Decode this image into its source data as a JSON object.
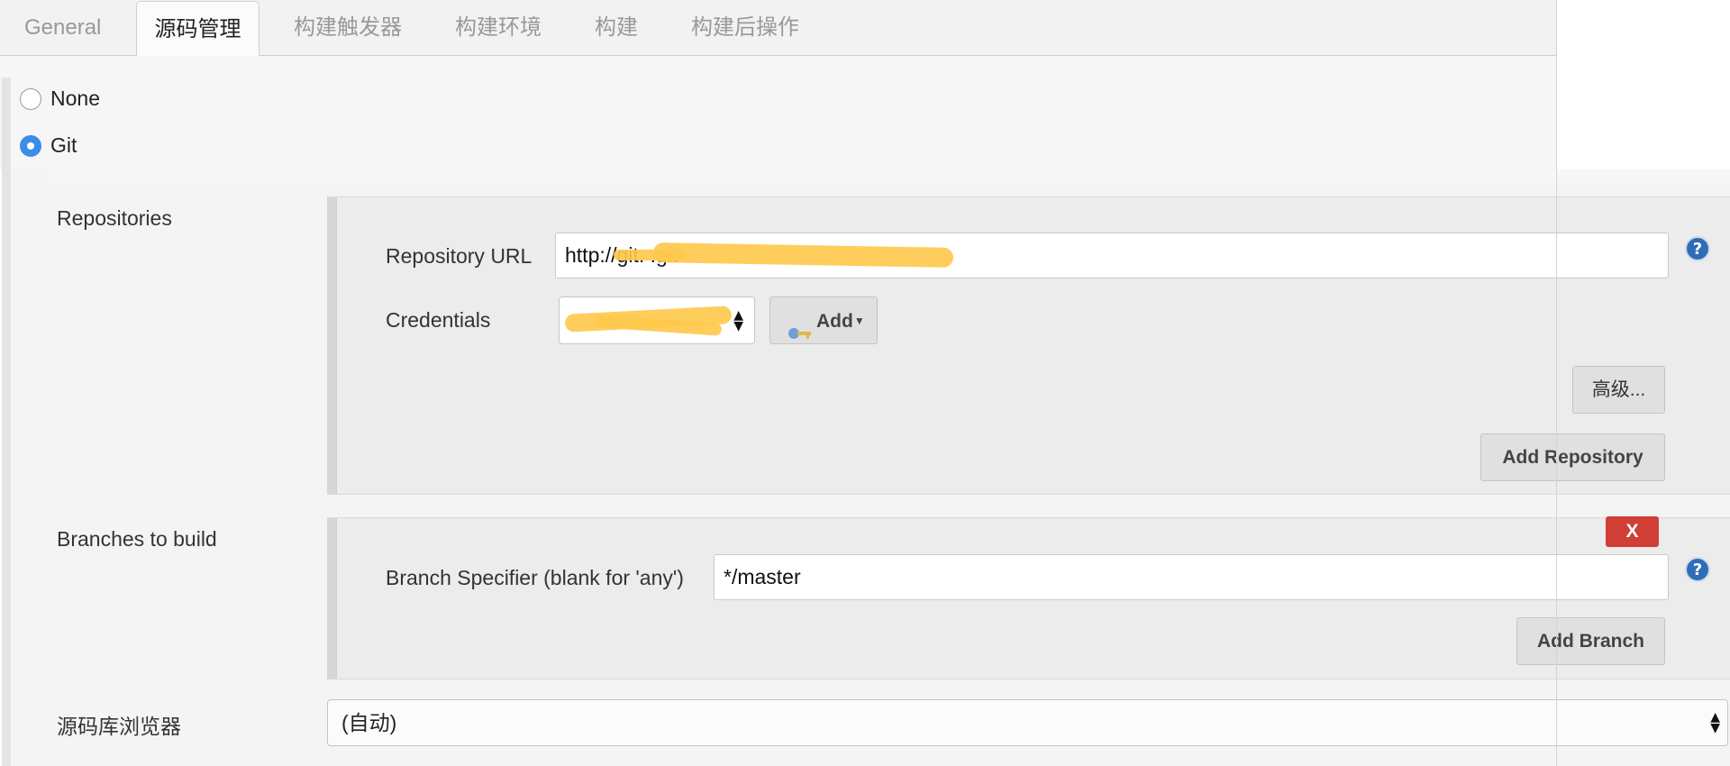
{
  "tabs": [
    {
      "label": "General",
      "active": false
    },
    {
      "label": "源码管理",
      "active": true
    },
    {
      "label": "构建触发器",
      "active": false
    },
    {
      "label": "构建环境",
      "active": false
    },
    {
      "label": "构建",
      "active": false
    },
    {
      "label": "构建后操作",
      "active": false
    }
  ],
  "scm": {
    "options": [
      {
        "label": "None",
        "selected": false
      },
      {
        "label": "Git",
        "selected": true
      }
    ]
  },
  "repositories": {
    "section_label": "Repositories",
    "url_label": "Repository URL",
    "url_value": "http://git.                                 .git",
    "credentials_label": "Credentials",
    "credentials_value": "",
    "add_label": "Add",
    "advanced_label": "高级...",
    "add_repository_label": "Add Repository"
  },
  "branches": {
    "section_label": "Branches to build",
    "specifier_label": "Branch Specifier (blank for 'any')",
    "specifier_value": "*/master",
    "delete_label": "X",
    "add_branch_label": "Add Branch"
  },
  "browser": {
    "label": "源码库浏览器",
    "value": "(自动)"
  },
  "icons": {
    "help": "help-icon",
    "key": "key-icon",
    "add_dropdown": "caret-down-icon",
    "select": "up-down-arrows-icon"
  },
  "colors": {
    "accent_radio": "#3b8ee8",
    "help_icon": "#2f6db5",
    "delete_button": "#cf3f35",
    "redaction": "#ffc94d"
  }
}
